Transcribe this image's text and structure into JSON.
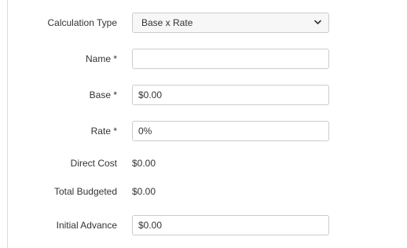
{
  "form": {
    "calculation_type": {
      "label": "Calculation Type",
      "selected": "Base x Rate",
      "chevron_icon": "chevron-down-icon"
    },
    "name": {
      "label": "Name *",
      "value": ""
    },
    "base": {
      "label": "Base *",
      "value": "$0.00"
    },
    "rate": {
      "label": "Rate *",
      "value": "0%"
    },
    "direct_cost": {
      "label": "Direct Cost",
      "value": "$0.00"
    },
    "total_budgeted": {
      "label": "Total Budgeted",
      "value": "$0.00"
    },
    "initial_advance": {
      "label": "Initial Advance",
      "value": "$0.00"
    }
  },
  "colors": {
    "border": "#cccccc",
    "text": "#333333",
    "frame_border": "#dddddd"
  }
}
